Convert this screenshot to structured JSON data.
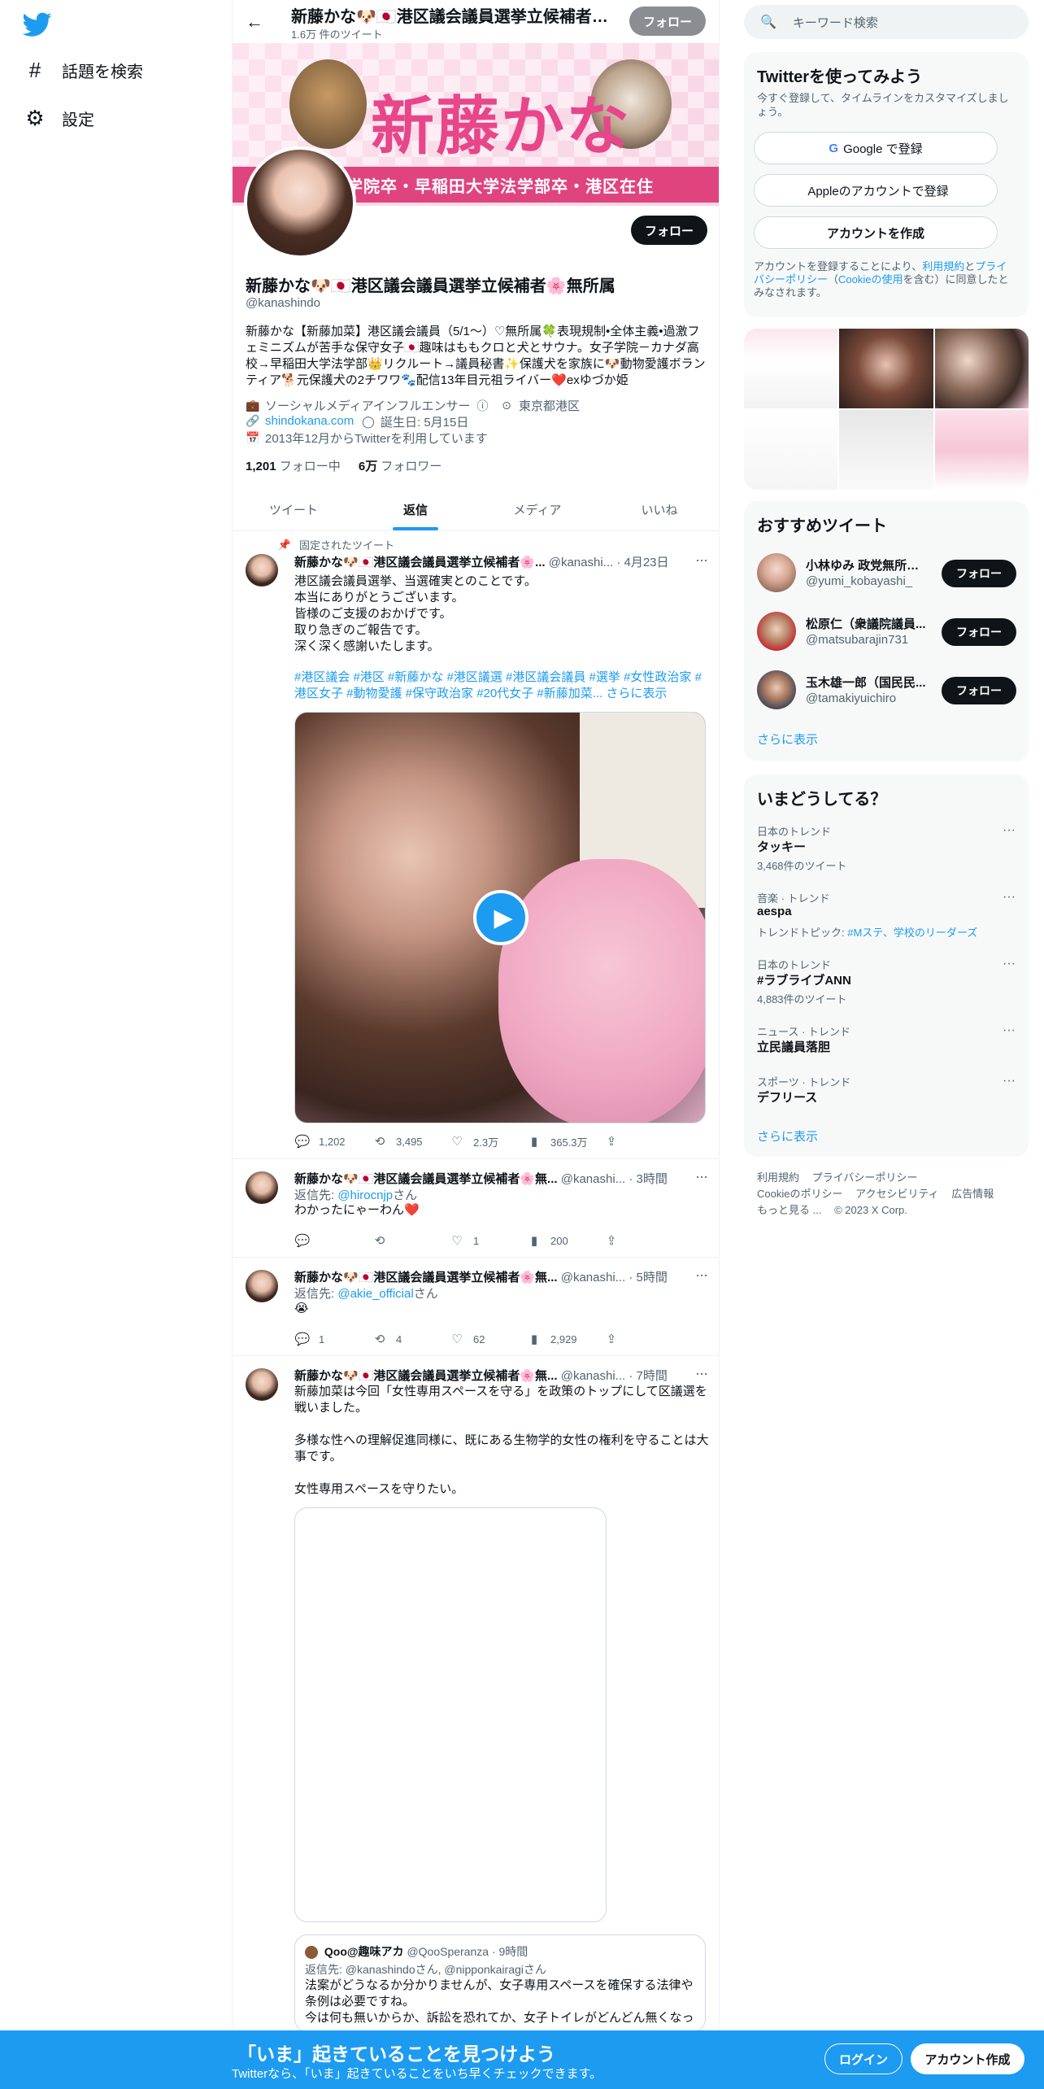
{
  "nav": {
    "explore_label": "話題を検索",
    "settings_label": "設定"
  },
  "topbar": {
    "name": "新藤かな🐶🇯🇵港区議会議員選挙立候補者🌸無所属",
    "tweet_count": "1.6万 件のツイート",
    "follow_label": "フォロー"
  },
  "banner": {
    "title": "新藤かな",
    "strip_text": "学院卒・早稲田大学法学部卒・港区在住"
  },
  "profile": {
    "follow_label": "フォロー",
    "name": "新藤かな🐶🇯🇵港区議会議員選挙立候補者🌸無所属",
    "handle": "@kanashindo",
    "bio": "新藤かな【新藤加菜】港区議会議員（5/1〜）♡無所属🍀表現規制•全体主義•過激フェミニズムが苦手な保守女子🇯🇵趣味はももクロと犬とサウナ。女子学院－カナダ高校→早稲田大学法学部👑リクルート→議員秘書✨保護犬を家族に🐶動物愛護ボランティア🐕元保護犬の2チワワ🐾配信13年目元祖ライバー❤️exゆづか姫",
    "category": "ソーシャルメディアインフルエンサー",
    "location": "東京都港区",
    "website": "shindokana.com",
    "birthday": "誕生日: 5月15日",
    "joined": "2013年12月からTwitterを利用しています",
    "following_count": "1,201",
    "following_label": "フォロー中",
    "followers_count": "6万",
    "followers_label": "フォロワー"
  },
  "tabs": [
    {
      "label": "ツイート"
    },
    {
      "label": "返信",
      "active": true
    },
    {
      "label": "メディア"
    },
    {
      "label": "いいね"
    }
  ],
  "tweets": [
    {
      "pinned_label": "固定されたツイート",
      "name": "新藤かな🐶🇯🇵港区議会議員選挙立候補者🌸...",
      "handle": "@kanashi...",
      "time": "· 4月23日",
      "text": "港区議会議員選挙、当選確実とのことです。\n本当にありがとうございます。\n皆様のご支援のおかげです。\n取り急ぎのご報告です。\n深く深く感謝いたします。",
      "hashtags": "#港区議会 #港区 #新藤かな #港区議選 #港区議会議員 #選挙 #女性政治家 #港区女子 #動物愛護 #保守政治家 #20代女子 #新藤加菜... さらに表示",
      "replies": "1,202",
      "retweets": "3,495",
      "likes": "2.3万",
      "views": "365.3万"
    },
    {
      "name": "新藤かな🐶🇯🇵港区議会議員選挙立候補者🌸無...",
      "handle": "@kanashi...",
      "time": "· 3時間",
      "reply_prefix": "返信先: ",
      "reply_to": "@hirocnjp",
      "reply_suffix": "さん",
      "text": "わかったにゃーわん❤️",
      "replies": "",
      "retweets": "",
      "likes": "1",
      "views": "200"
    },
    {
      "name": "新藤かな🐶🇯🇵港区議会議員選挙立候補者🌸無...",
      "handle": "@kanashi...",
      "time": "· 5時間",
      "reply_prefix": "返信先: ",
      "reply_to": "@akie_official",
      "reply_suffix": "さん",
      "text": "😭",
      "replies": "1",
      "retweets": "4",
      "likes": "62",
      "views": "2,929"
    },
    {
      "name": "新藤かな🐶🇯🇵港区議会議員選挙立候補者🌸無...",
      "handle": "@kanashi...",
      "time": "· 7時間",
      "text": "新藤加菜は今回「女性専用スペースを守る」を政策のトップにして区議選を戦いました。\n\n多様な性への理解促進同様に、既にある生物学的女性の権利を守ることは大事です。\n\n女性専用スペースを守りたい。",
      "quote": {
        "name": "Qoo@趣味アカ",
        "handle": "@QooSperanza",
        "time": "· 9時間",
        "reply_prefix": "返信先: ",
        "reply_to": "@kanashindoさん, @nipponkairagiさん",
        "text": "法案がどうなるか分かりませんが、女子専用スペースを確保する法律や条例は必要ですね。\n今は何も無いからか、訴訟を恐れてか、女子トイレがどんどん無くなっ"
      }
    }
  ],
  "sidebar": {
    "search_placeholder": "キーワード検索",
    "signup": {
      "title": "Twitterを使ってみよう",
      "subtitle": "今すぐ登録して、タイムラインをカスタマイズしましょう。",
      "google": "Google で登録",
      "apple": "Appleのアカウントで登録",
      "create": "アカウントを作成",
      "legal_pre": "アカウントを登録することにより、",
      "legal_terms": "利用規約",
      "legal_mid": "と",
      "legal_privacy": "プライバシーポリシー",
      "legal_mid2": "（",
      "legal_cookie": "Cookieの使用",
      "legal_post": "を含む）に同意したとみなされます。"
    },
    "who_to_follow": {
      "title": "おすすめツイート",
      "users": [
        {
          "name": "小林ゆみ 政党無所属...",
          "handle": "@yumi_kobayashi_",
          "button": "フォロー"
        },
        {
          "name": "松原仁（衆議院議員...",
          "handle": "@matsubarajin731",
          "button": "フォロー"
        },
        {
          "name": "玉木雄一郎（国民民...",
          "handle": "@tamakiyuichiro",
          "button": "フォロー"
        }
      ],
      "more": "さらに表示"
    },
    "trends": {
      "title": "いまどうしてる？",
      "items": [
        {
          "category": "日本のトレンド",
          "name": "タッキー",
          "sub": "3,468件のツイート"
        },
        {
          "category": "音楽 · トレンド",
          "name": "aespa",
          "sub_pre": "トレンドトピック: ",
          "sub_link": "#Mステ、学校のリーダーズ"
        },
        {
          "category": "日本のトレンド",
          "name": "#ラブライブANN",
          "sub": "4,883件のツイート"
        },
        {
          "category": "ニュース · トレンド",
          "name": "立民議員落胆"
        },
        {
          "category": "スポーツ · トレンド",
          "name": "デフリース"
        }
      ],
      "more": "さらに表示"
    },
    "footer": {
      "terms": "利用規約",
      "privacy": "プライバシーポリシー",
      "cookie": "Cookieのポリシー",
      "accessibility": "アクセシビリティ",
      "ads": "広告情報",
      "more": "もっと見る ...",
      "copyright": "© 2023 X Corp."
    }
  },
  "bottom_bar": {
    "title": "「いま」起きていることを見つけよう",
    "subtitle": "Twitterなら、「いま」起きていることをいち早くチェックできます。",
    "login": "ログイン",
    "signup": "アカウント作成"
  },
  "colors": {
    "accent": "#1d9bf0",
    "banner_pink": "#e8468a"
  }
}
